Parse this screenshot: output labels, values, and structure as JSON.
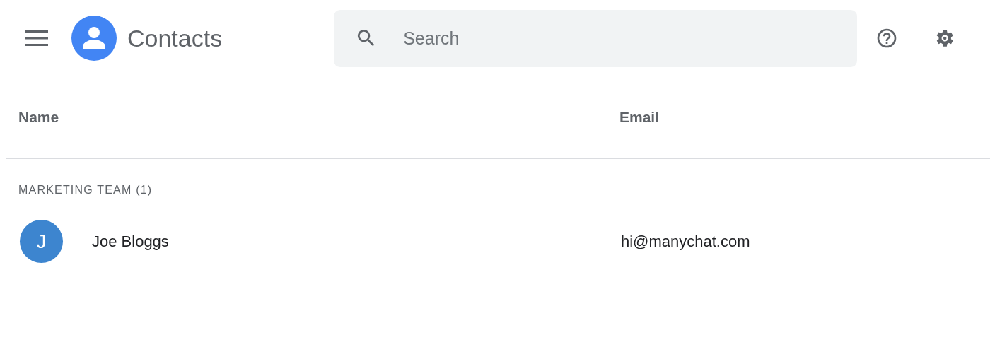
{
  "app": {
    "title": "Contacts"
  },
  "search": {
    "placeholder": "Search"
  },
  "table": {
    "columns": [
      "Name",
      "Email"
    ],
    "groups": [
      {
        "label": "MARKETING TEAM (1)",
        "rows": [
          {
            "initial": "J",
            "color": "#3d85cf",
            "name": "Joe Bloggs",
            "email": "hi@manychat.com"
          }
        ]
      }
    ]
  }
}
